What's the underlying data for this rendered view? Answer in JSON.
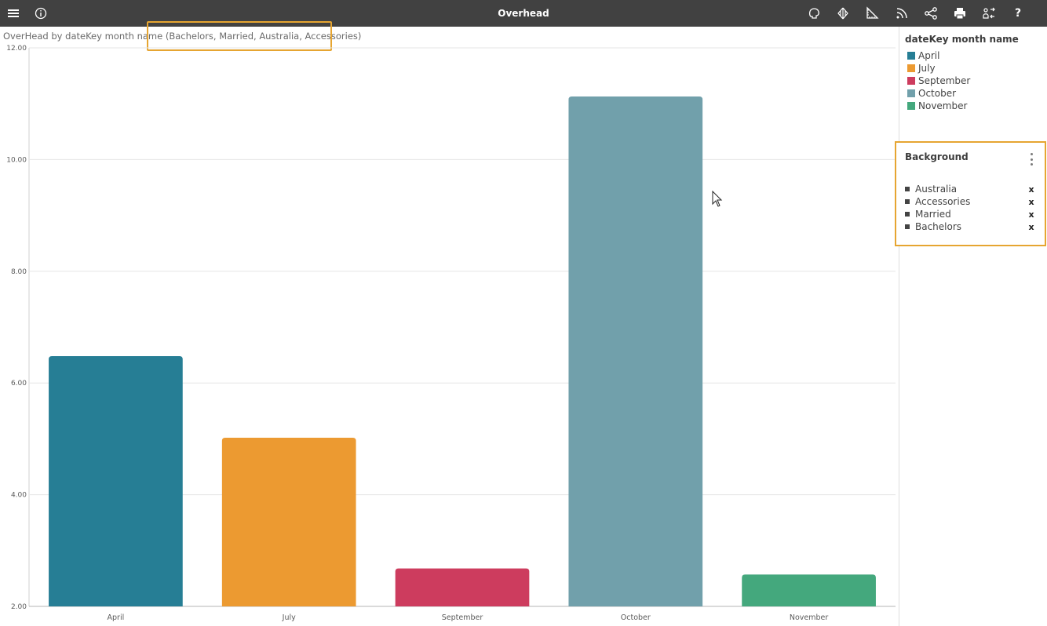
{
  "header": {
    "title": "Overhead",
    "icons": [
      "menu-icon",
      "info-icon",
      "brain-icon",
      "layers-icon",
      "ruler-icon",
      "feed-icon",
      "share-icon",
      "print-icon",
      "swap-icon",
      "help-icon"
    ],
    "help_label": "?"
  },
  "chart_title": "OverHead by dateKey month name",
  "filter_summary": "(Bachelors, Married, Australia, Accessories)",
  "chart_data": {
    "type": "bar",
    "title": "OverHead by dateKey month name (Bachelors, Married, Australia, Accessories)",
    "categories": [
      "April",
      "July",
      "September",
      "October",
      "November"
    ],
    "values": [
      6.48,
      5.02,
      2.68,
      11.13,
      2.57
    ],
    "colors": [
      "#267e95",
      "#ec9a31",
      "#cd3c5e",
      "#71a0ab",
      "#44a87d"
    ],
    "ylim": [
      2,
      12
    ],
    "yticks": [
      2,
      4,
      6,
      8,
      10,
      12
    ],
    "ytick_labels": [
      "2.00",
      "4.00",
      "6.00",
      "8.00",
      "10.00",
      "12.00"
    ],
    "grid": true,
    "legend": "right"
  },
  "legend": {
    "title": "dateKey month name",
    "items": [
      {
        "label": "April",
        "color": "#267e95"
      },
      {
        "label": "July",
        "color": "#ec9a31"
      },
      {
        "label": "September",
        "color": "#cd3c5e"
      },
      {
        "label": "October",
        "color": "#71a0ab"
      },
      {
        "label": "November",
        "color": "#44a87d"
      }
    ]
  },
  "background_panel": {
    "title": "Background",
    "remove_label": "x",
    "items": [
      "Australia",
      "Accessories",
      "Married",
      "Bachelors"
    ]
  },
  "accent_color": "#e6a531"
}
